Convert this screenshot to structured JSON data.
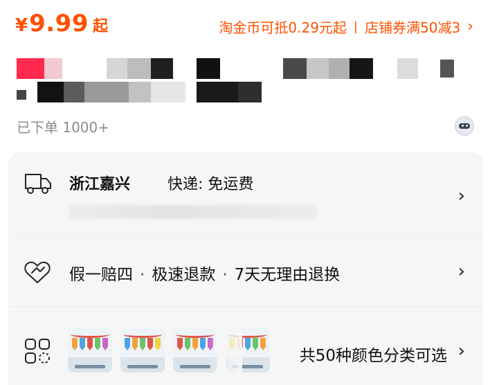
{
  "price": {
    "currency": "¥",
    "value": "9.99",
    "suffix": "起"
  },
  "promo": {
    "coin_text": "淘金币可抵0.29元起",
    "separator": "|",
    "coupon_text": "店铺券满50减3",
    "chevron": "›"
  },
  "sales": {
    "text": "已下单 1000+"
  },
  "shipping": {
    "location": "浙江嘉兴",
    "method_text": "快递: 免运费",
    "chevron": "›"
  },
  "guarantee": {
    "items": [
      "假一赔四",
      "极速退款",
      "7天无理由退换"
    ],
    "dot": "·",
    "chevron": "›"
  },
  "variants": {
    "text": "共50种颜色分类可选",
    "chevron": "›"
  },
  "colors": {
    "accent": "#ff5000",
    "card_bg": "#f6f6f6",
    "muted": "#8c8c8c"
  },
  "icons": [
    "truck-icon",
    "heart-shield-icon",
    "variants-grid-icon",
    "assistant-bot-icon",
    "chevron-right-icon"
  ]
}
